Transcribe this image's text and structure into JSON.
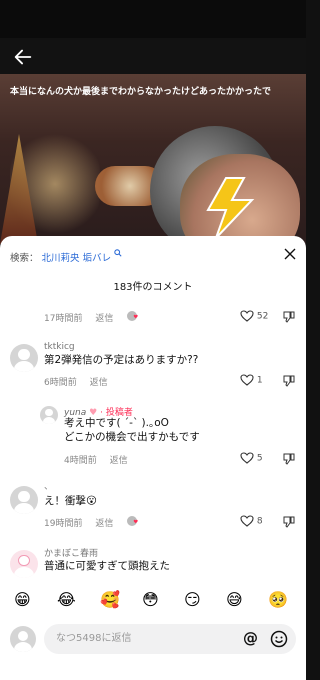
{
  "video": {
    "caption": "本当になんの犬か最後までわからなかったけどあったかかったで"
  },
  "comments_panel": {
    "search_prefix": "検索：",
    "search_query": "北川莉央 垢バレ",
    "comment_count": "183件のコメント",
    "partial_top": {
      "time": "17時間前",
      "reply_label": "返信",
      "likes": "52"
    },
    "comments": [
      {
        "user": "tktkicg",
        "text": "第2弾発信の予定はありますか??",
        "time": "6時間前",
        "reply_label": "返信",
        "likes": "1"
      },
      {
        "user": "yuna",
        "badge": "投稿者",
        "text_line1": "考え中です( ˊ-ˋ ).｡oO",
        "text_line2": "どこかの機会で出すかもです",
        "time": "4時間前",
        "reply_label": "返信",
        "likes": "5"
      },
      {
        "user": "、",
        "text": "え！衝撃😮",
        "time": "19時間前",
        "reply_label": "返信",
        "likes": "8"
      },
      {
        "user": "かまぼこ春雨",
        "text": "普通に可愛すぎて頭抱えた"
      }
    ]
  },
  "emoji_bar": [
    "😁",
    "😂",
    "🥰",
    "😳",
    "😏",
    "😅",
    "🥺"
  ],
  "reply_input": {
    "placeholder": "なつ5498に返信",
    "at_symbol": "@"
  },
  "colors": {
    "link_blue": "#2c6bd6",
    "heart_pink": "#fe2c55",
    "badge_pink": "#fe2c55"
  }
}
